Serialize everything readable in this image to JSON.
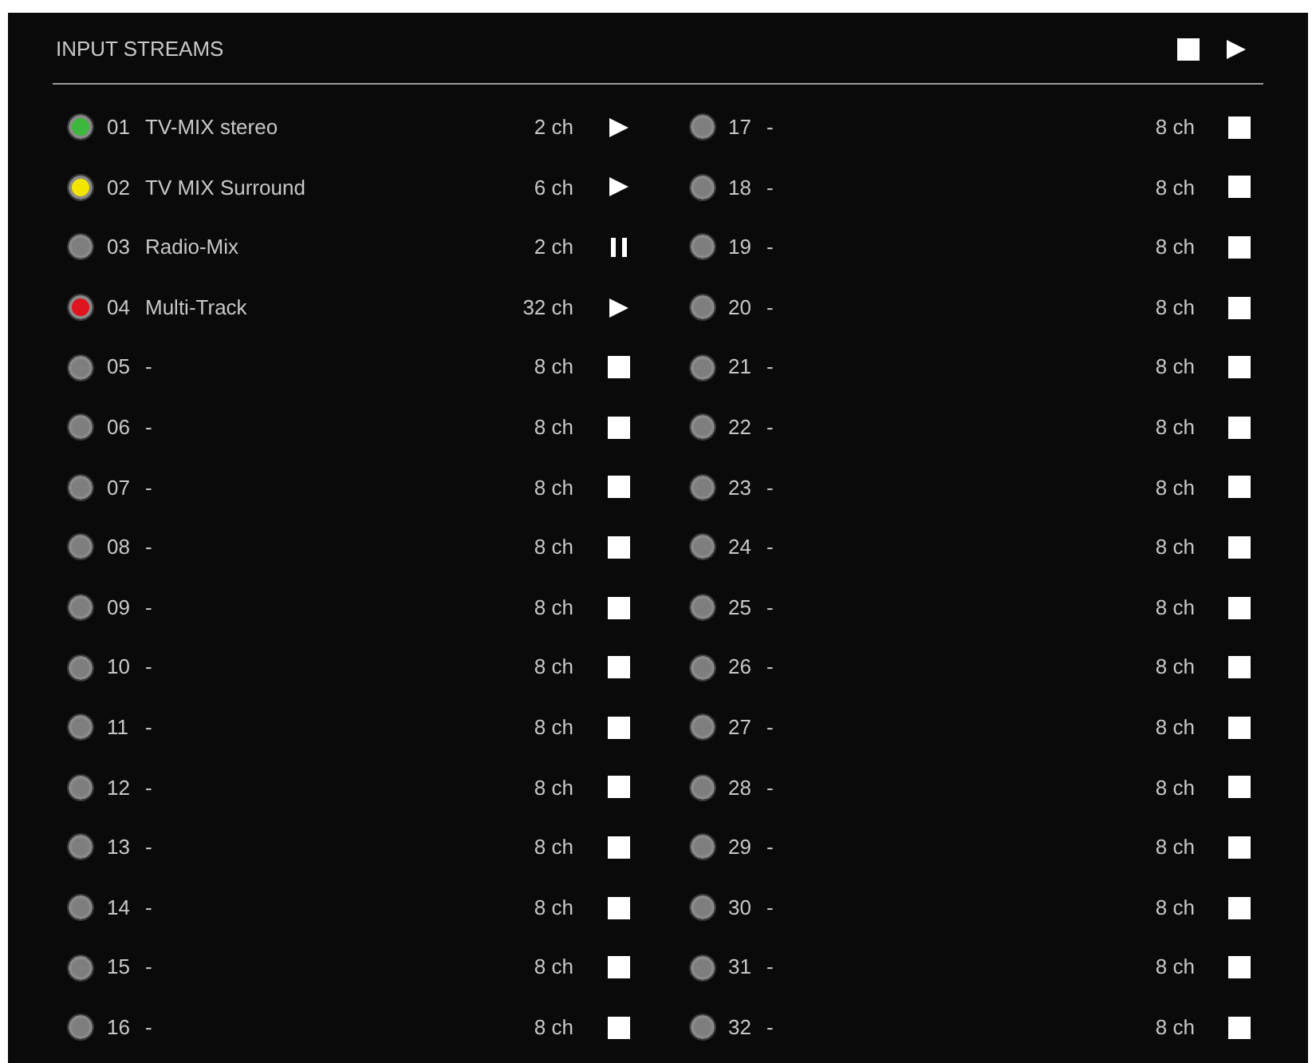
{
  "panel": {
    "title": "INPUT STREAMS",
    "controls": [
      {
        "kind": "stop"
      },
      {
        "kind": "play"
      }
    ]
  },
  "streams": [
    {
      "number": "01",
      "name": "TV-MIX stereo",
      "channels": "2 ch",
      "color": "#3cb83c",
      "kind": "playing"
    },
    {
      "number": "02",
      "name": "TV MIX Surround",
      "channels": "6 ch",
      "color": "#f2e600",
      "kind": "playing"
    },
    {
      "number": "03",
      "name": "Radio-Mix",
      "channels": "2 ch",
      "color": "#7e7e7e",
      "kind": "paused"
    },
    {
      "number": "04",
      "name": "Multi-Track",
      "channels": "32 ch",
      "color": "#e0141e",
      "kind": "playing"
    },
    {
      "number": "05",
      "name": "-",
      "channels": "8 ch",
      "color": "#7e7e7e",
      "kind": "stopped"
    },
    {
      "number": "06",
      "name": "-",
      "channels": "8 ch",
      "color": "#7e7e7e",
      "kind": "stopped"
    },
    {
      "number": "07",
      "name": "-",
      "channels": "8 ch",
      "color": "#7e7e7e",
      "kind": "stopped"
    },
    {
      "number": "08",
      "name": "-",
      "channels": "8 ch",
      "color": "#7e7e7e",
      "kind": "stopped"
    },
    {
      "number": "09",
      "name": "-",
      "channels": "8 ch",
      "color": "#7e7e7e",
      "kind": "stopped"
    },
    {
      "number": "10",
      "name": "-",
      "channels": "8 ch",
      "color": "#7e7e7e",
      "kind": "stopped"
    },
    {
      "number": "11",
      "name": "-",
      "channels": "8 ch",
      "color": "#7e7e7e",
      "kind": "stopped"
    },
    {
      "number": "12",
      "name": "-",
      "channels": "8 ch",
      "color": "#7e7e7e",
      "kind": "stopped"
    },
    {
      "number": "13",
      "name": "-",
      "channels": "8 ch",
      "color": "#7e7e7e",
      "kind": "stopped"
    },
    {
      "number": "14",
      "name": "-",
      "channels": "8 ch",
      "color": "#7e7e7e",
      "kind": "stopped"
    },
    {
      "number": "15",
      "name": "-",
      "channels": "8 ch",
      "color": "#7e7e7e",
      "kind": "stopped"
    },
    {
      "number": "16",
      "name": "-",
      "channels": "8 ch",
      "color": "#7e7e7e",
      "kind": "stopped"
    },
    {
      "number": "17",
      "name": "-",
      "channels": "8 ch",
      "color": "#7e7e7e",
      "kind": "stopped"
    },
    {
      "number": "18",
      "name": "-",
      "channels": "8 ch",
      "color": "#7e7e7e",
      "kind": "stopped"
    },
    {
      "number": "19",
      "name": "-",
      "channels": "8 ch",
      "color": "#7e7e7e",
      "kind": "stopped"
    },
    {
      "number": "20",
      "name": "-",
      "channels": "8 ch",
      "color": "#7e7e7e",
      "kind": "stopped"
    },
    {
      "number": "21",
      "name": "-",
      "channels": "8 ch",
      "color": "#7e7e7e",
      "kind": "stopped"
    },
    {
      "number": "22",
      "name": "-",
      "channels": "8 ch",
      "color": "#7e7e7e",
      "kind": "stopped"
    },
    {
      "number": "23",
      "name": "-",
      "channels": "8 ch",
      "color": "#7e7e7e",
      "kind": "stopped"
    },
    {
      "number": "24",
      "name": "-",
      "channels": "8 ch",
      "color": "#7e7e7e",
      "kind": "stopped"
    },
    {
      "number": "25",
      "name": "-",
      "channels": "8 ch",
      "color": "#7e7e7e",
      "kind": "stopped"
    },
    {
      "number": "26",
      "name": "-",
      "channels": "8 ch",
      "color": "#7e7e7e",
      "kind": "stopped"
    },
    {
      "number": "27",
      "name": "-",
      "channels": "8 ch",
      "color": "#7e7e7e",
      "kind": "stopped"
    },
    {
      "number": "28",
      "name": "-",
      "channels": "8 ch",
      "color": "#7e7e7e",
      "kind": "stopped"
    },
    {
      "number": "29",
      "name": "-",
      "channels": "8 ch",
      "color": "#7e7e7e",
      "kind": "stopped"
    },
    {
      "number": "30",
      "name": "-",
      "channels": "8 ch",
      "color": "#7e7e7e",
      "kind": "stopped"
    },
    {
      "number": "31",
      "name": "-",
      "channels": "8 ch",
      "color": "#7e7e7e",
      "kind": "stopped"
    },
    {
      "number": "32",
      "name": "-",
      "channels": "8 ch",
      "color": "#7e7e7e",
      "kind": "stopped"
    }
  ]
}
